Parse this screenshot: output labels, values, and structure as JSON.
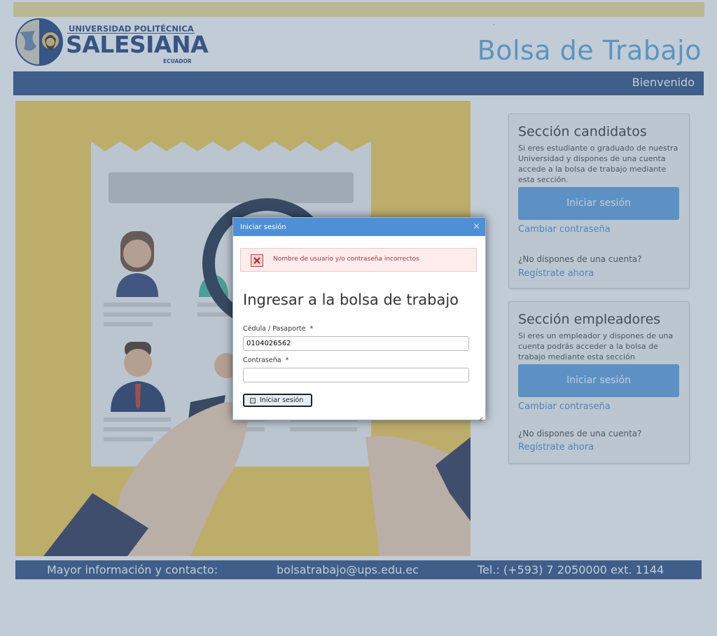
{
  "header": {
    "logo": {
      "line1": "UNIVERSIDAD POLITÉCNICA",
      "line2": "SALESIANA",
      "line3": "ECUADOR"
    },
    "title": "Bolsa de Trabajo",
    "dot": "."
  },
  "nav": {
    "welcome": "Bienvenido"
  },
  "candidates": {
    "title": "Sección candidatos",
    "description": "Si eres estudiante o graduado de nuestra Universidad y dispones de una cuenta accede a la bolsa de trabajo mediante esta sección.",
    "login_label": "Iniciar sesión",
    "change_password": "Cambiar contraseña",
    "no_account": "¿No dispones de una cuenta?",
    "register": "Regístrate ahora"
  },
  "employers": {
    "title": "Sección empleadores",
    "description": "Si eres un empleador y dispones de una cuenta podrás acceder a la bolsa de trabajo mediante esta sección",
    "login_label": "Iniciar sesión",
    "change_password": "Cambiar contraseña",
    "no_account": "¿No dispones de una cuenta?",
    "register": "Regístrate ahora"
  },
  "footer": {
    "contact_label": "Mayor información y contacto:",
    "email": "bolsatrabajo@ups.edu.ec",
    "phone": "Tel.: (+593) 7 2050000 ext. 1144"
  },
  "dialog": {
    "title": "Iniciar sesión",
    "close_glyph": "×",
    "error_message": "Nombre de usuario y/o contraseña incorrectos",
    "heading": "Ingresar a la bolsa de trabajo",
    "id_label": "Cédula / Pasaporte",
    "id_value": "0104026562",
    "password_label": "Contraseña",
    "required_mark": "*",
    "password_value": "",
    "submit_label": "Iniciar sesión"
  },
  "colors": {
    "brand_navy": "#2c4e82",
    "title_blue": "#5aa6d8",
    "button_blue": "#5da0e0",
    "hero_yellow": "#f6cd52",
    "error_red": "#a23838"
  },
  "icons": {
    "error": "error-x-icon",
    "submit": "save-icon",
    "close": "close-icon",
    "resize": "resize-grip-icon"
  }
}
